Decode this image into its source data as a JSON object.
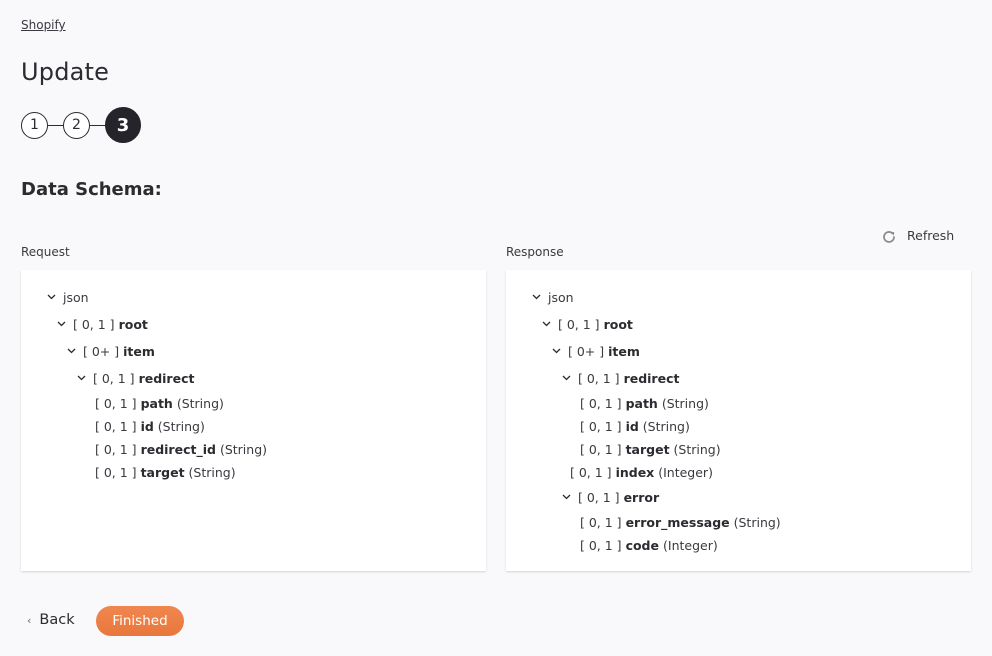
{
  "breadcrumb": "Shopify",
  "title": "Update",
  "steps": [
    {
      "label": "1",
      "active": false
    },
    {
      "label": "2",
      "active": false
    },
    {
      "label": "3",
      "active": true
    }
  ],
  "section_title": "Data Schema:",
  "refresh_label": "Refresh",
  "request": {
    "label": "Request",
    "nodes": [
      {
        "depth": 0,
        "expandable": true,
        "cardinality": "",
        "name": "json",
        "type": ""
      },
      {
        "depth": 1,
        "expandable": true,
        "cardinality": "[ 0, 1 ]",
        "name": "root",
        "type": ""
      },
      {
        "depth": 2,
        "expandable": true,
        "cardinality": "[ 0+ ]",
        "name": "item",
        "type": ""
      },
      {
        "depth": 3,
        "expandable": true,
        "cardinality": "[ 0, 1 ]",
        "name": "redirect",
        "type": ""
      },
      {
        "depth": 4,
        "expandable": false,
        "cardinality": "[ 0, 1 ]",
        "name": "path",
        "type": "(String)"
      },
      {
        "depth": 4,
        "expandable": false,
        "cardinality": "[ 0, 1 ]",
        "name": "id",
        "type": "(String)"
      },
      {
        "depth": 4,
        "expandable": false,
        "cardinality": "[ 0, 1 ]",
        "name": "redirect_id",
        "type": "(String)"
      },
      {
        "depth": 4,
        "expandable": false,
        "cardinality": "[ 0, 1 ]",
        "name": "target",
        "type": "(String)"
      }
    ]
  },
  "response": {
    "label": "Response",
    "nodes": [
      {
        "depth": 0,
        "expandable": true,
        "cardinality": "",
        "name": "json",
        "type": ""
      },
      {
        "depth": 1,
        "expandable": true,
        "cardinality": "[ 0, 1 ]",
        "name": "root",
        "type": ""
      },
      {
        "depth": 2,
        "expandable": true,
        "cardinality": "[ 0+ ]",
        "name": "item",
        "type": ""
      },
      {
        "depth": 3,
        "expandable": true,
        "cardinality": "[ 0, 1 ]",
        "name": "redirect",
        "type": ""
      },
      {
        "depth": 4,
        "expandable": false,
        "cardinality": "[ 0, 1 ]",
        "name": "path",
        "type": "(String)"
      },
      {
        "depth": 4,
        "expandable": false,
        "cardinality": "[ 0, 1 ]",
        "name": "id",
        "type": "(String)"
      },
      {
        "depth": 4,
        "expandable": false,
        "cardinality": "[ 0, 1 ]",
        "name": "target",
        "type": "(String)"
      },
      {
        "depth": 3,
        "expandable": false,
        "cardinality": "[ 0, 1 ]",
        "name": "index",
        "type": "(Integer)"
      },
      {
        "depth": 3,
        "expandable": true,
        "cardinality": "[ 0, 1 ]",
        "name": "error",
        "type": ""
      },
      {
        "depth": 4,
        "expandable": false,
        "cardinality": "[ 0, 1 ]",
        "name": "error_message",
        "type": "(String)"
      },
      {
        "depth": 4,
        "expandable": false,
        "cardinality": "[ 0, 1 ]",
        "name": "code",
        "type": "(Integer)"
      }
    ]
  },
  "footer": {
    "back_label": "Back",
    "finished_label": "Finished"
  },
  "colors": {
    "accent": "#ee7f45",
    "step_active": "#24242a"
  }
}
